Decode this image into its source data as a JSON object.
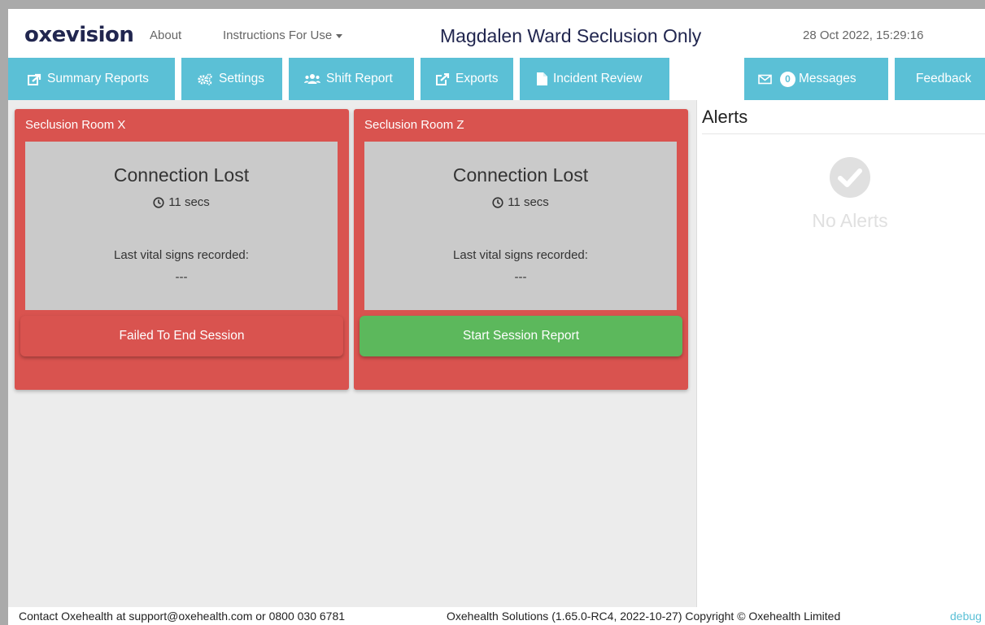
{
  "header": {
    "logo": "oxevision",
    "about": "About",
    "instructions": "Instructions For Use",
    "ward_title": "Magdalen Ward Seclusion Only",
    "datetime": "28 Oct 2022, 15:29:16"
  },
  "nav": {
    "summary_reports": "Summary Reports",
    "settings": "Settings",
    "shift_report": "Shift Report",
    "exports": "Exports",
    "incident_review": "Incident Review",
    "messages_count": "0",
    "messages": "Messages",
    "feedback": "Feedback"
  },
  "rooms": [
    {
      "name": "Seclusion Room X",
      "status": "Connection Lost",
      "elapsed": "11 secs",
      "vitals_label": "Last vital signs recorded:",
      "vitals_value": "---",
      "button": "Failed To End Session"
    },
    {
      "name": "Seclusion Room Z",
      "status": "Connection Lost",
      "elapsed": "11 secs",
      "vitals_label": "Last vital signs recorded:",
      "vitals_value": "---",
      "button": "Start Session Report"
    }
  ],
  "alerts": {
    "title": "Alerts",
    "empty": "No Alerts"
  },
  "footer": {
    "contact": "Contact Oxehealth at support@oxehealth.com or 0800 030 6781",
    "copyright": "Oxehealth Solutions (1.65.0-RC4, 2022-10-27) Copyright © Oxehealth Limited",
    "debug": "debug"
  },
  "colors": {
    "brand_navy": "#21264f",
    "nav_bg": "#5bc0d6",
    "room_alert_red": "#d9534f",
    "start_green": "#5cb85c",
    "panel_grey": "#cacaca"
  }
}
